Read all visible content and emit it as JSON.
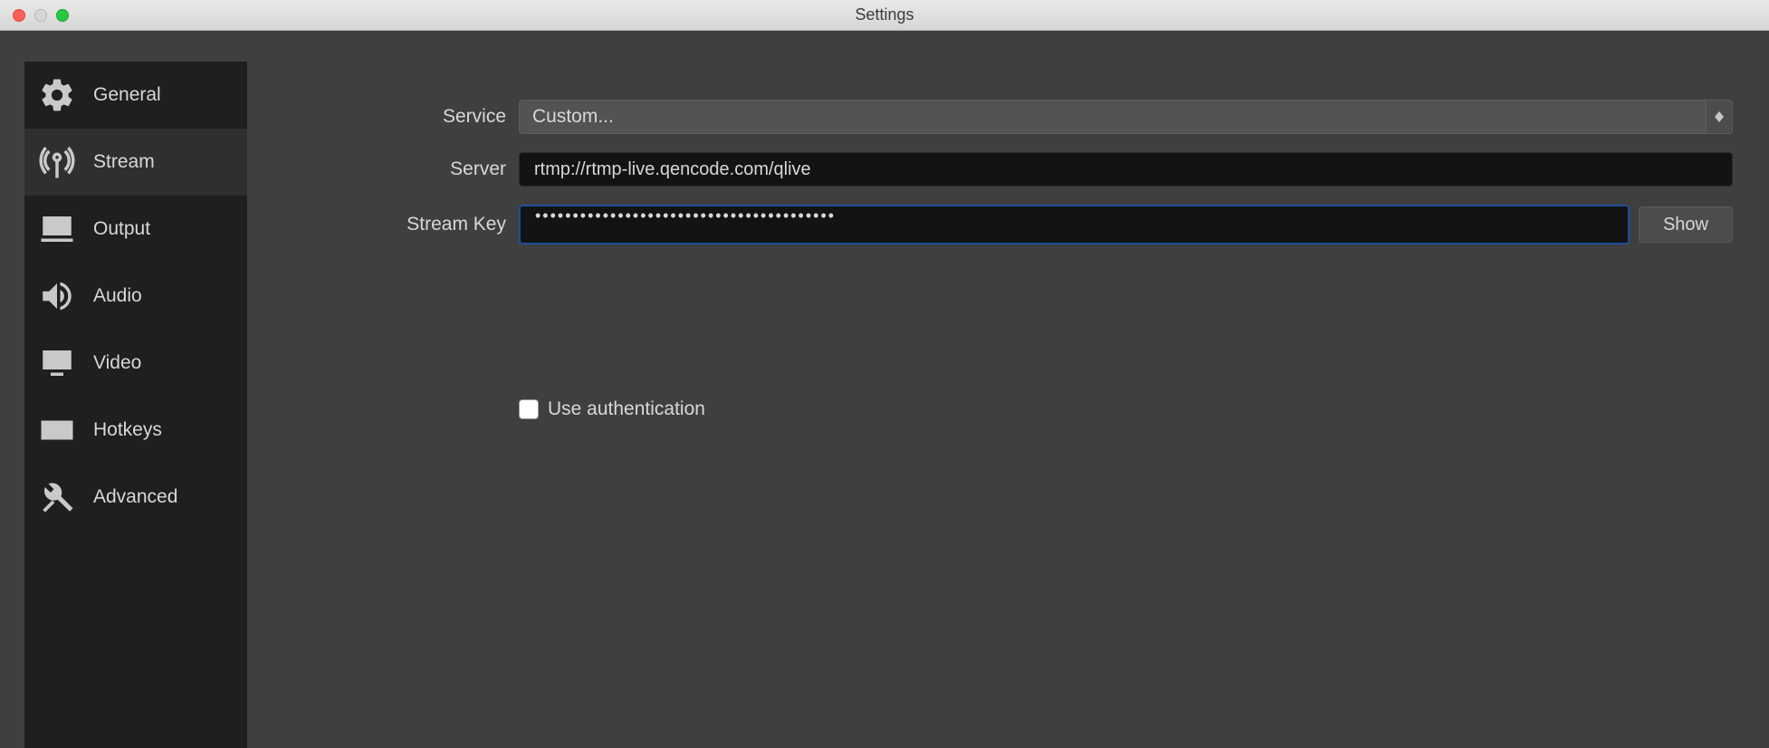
{
  "window": {
    "title": "Settings"
  },
  "sidebar": {
    "items": [
      {
        "label": "General"
      },
      {
        "label": "Stream"
      },
      {
        "label": "Output"
      },
      {
        "label": "Audio"
      },
      {
        "label": "Video"
      },
      {
        "label": "Hotkeys"
      },
      {
        "label": "Advanced"
      }
    ],
    "active_index": 1
  },
  "form": {
    "service": {
      "label": "Service",
      "value": "Custom..."
    },
    "server": {
      "label": "Server",
      "value": "rtmp://rtmp-live.qencode.com/qlive"
    },
    "stream_key": {
      "label": "Stream Key",
      "masked_value": "••••••••••••••••••••••••••••••••••••••••",
      "show_button": "Show"
    },
    "use_auth": {
      "label": "Use authentication",
      "checked": false
    }
  }
}
